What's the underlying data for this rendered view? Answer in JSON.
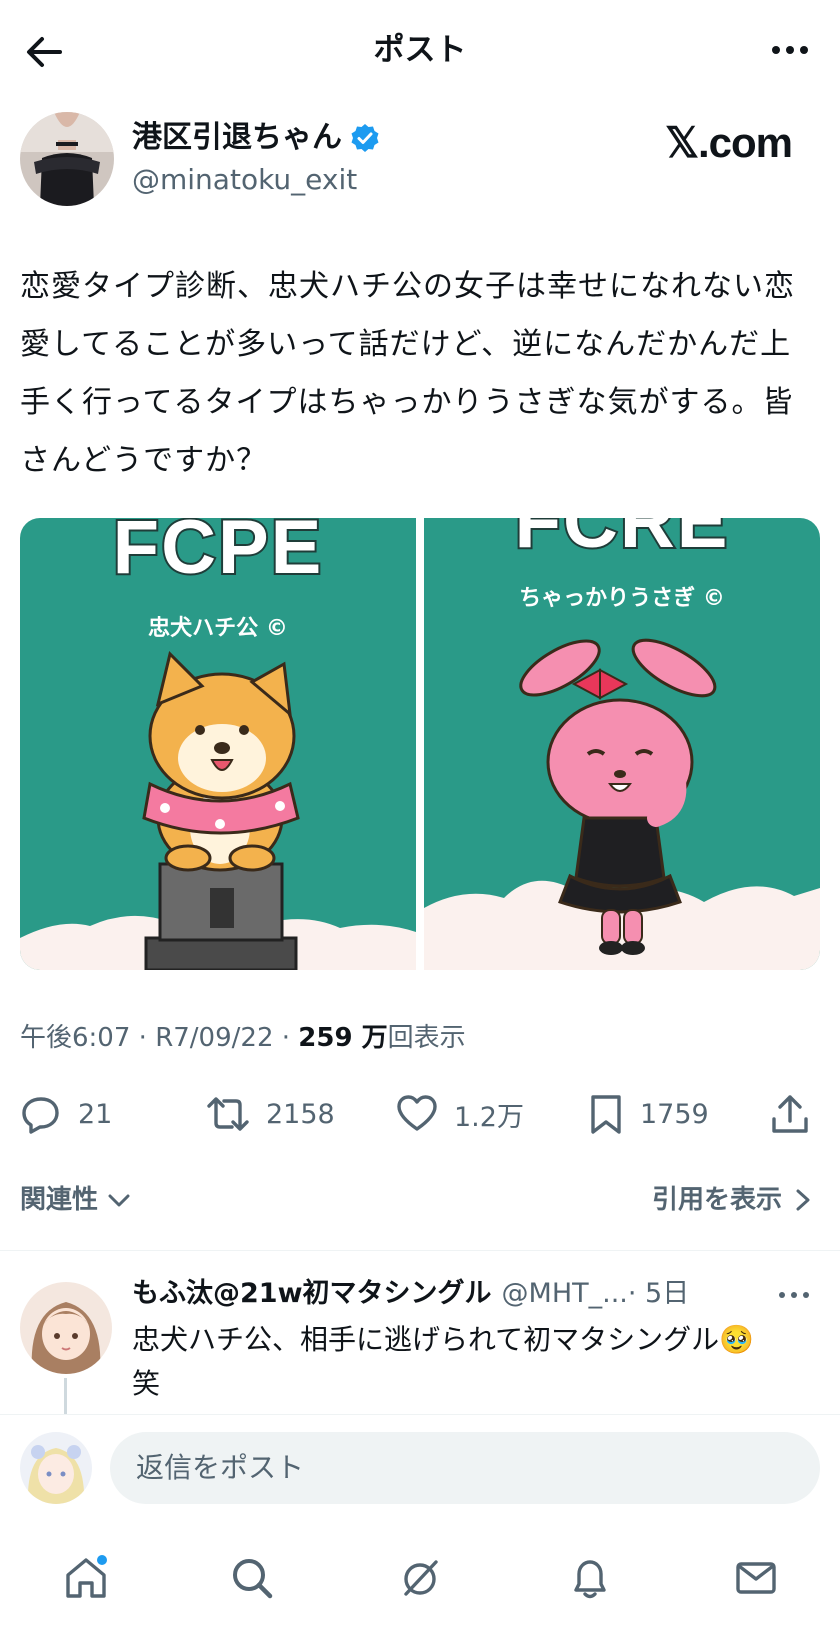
{
  "header": {
    "title": "ポスト"
  },
  "author": {
    "display_name": "港区引退ちゃん",
    "handle": "@minatoku_exit",
    "verified": true
  },
  "watermark": "𝕏.com",
  "tweet": {
    "text": "恋愛タイプ診断、忠犬ハチ公の女子は幸せになれない恋愛してることが多いって話だけど、逆になんだかんだ上手く行ってるタイプはちゃっかりうさぎな気がする。皆さんどうですか？"
  },
  "media": {
    "left": {
      "code": "FCPE",
      "caption": "忠犬ハチ公 ©"
    },
    "right": {
      "code": "FCRE",
      "caption": "ちゃっかりうさぎ ©"
    }
  },
  "meta": {
    "time": "午後6:07",
    "sep1": " · ",
    "date": "R7/09/22",
    "sep2": " · ",
    "views": "259 万",
    "views_suffix": "回表示"
  },
  "actions": {
    "replies": "21",
    "retweets": "2158",
    "likes": "1.2万",
    "bookmarks": "1759"
  },
  "sort": {
    "label": "関連性",
    "quotes_link": "引用を表示"
  },
  "reply": {
    "name": "もふ汰@21w初マタシングル",
    "handle": "@MHT_...",
    "age": "· 5日",
    "text": "忠犬ハチ公、相手に逃げられて初マタシングル🥹笑"
  },
  "compose": {
    "placeholder": "返信をポスト"
  },
  "colors": {
    "accent": "#1d9bf0",
    "card_bg": "#2a9a88",
    "secondary_text": "#536471"
  },
  "icons": [
    "back-arrow-icon",
    "more-icon",
    "verified-badge-icon",
    "reply-icon",
    "retweet-icon",
    "like-icon",
    "bookmark-icon",
    "share-icon",
    "chevron-down-icon",
    "chevron-right-icon",
    "home-icon",
    "search-icon",
    "grok-icon",
    "notifications-icon",
    "messages-icon"
  ]
}
